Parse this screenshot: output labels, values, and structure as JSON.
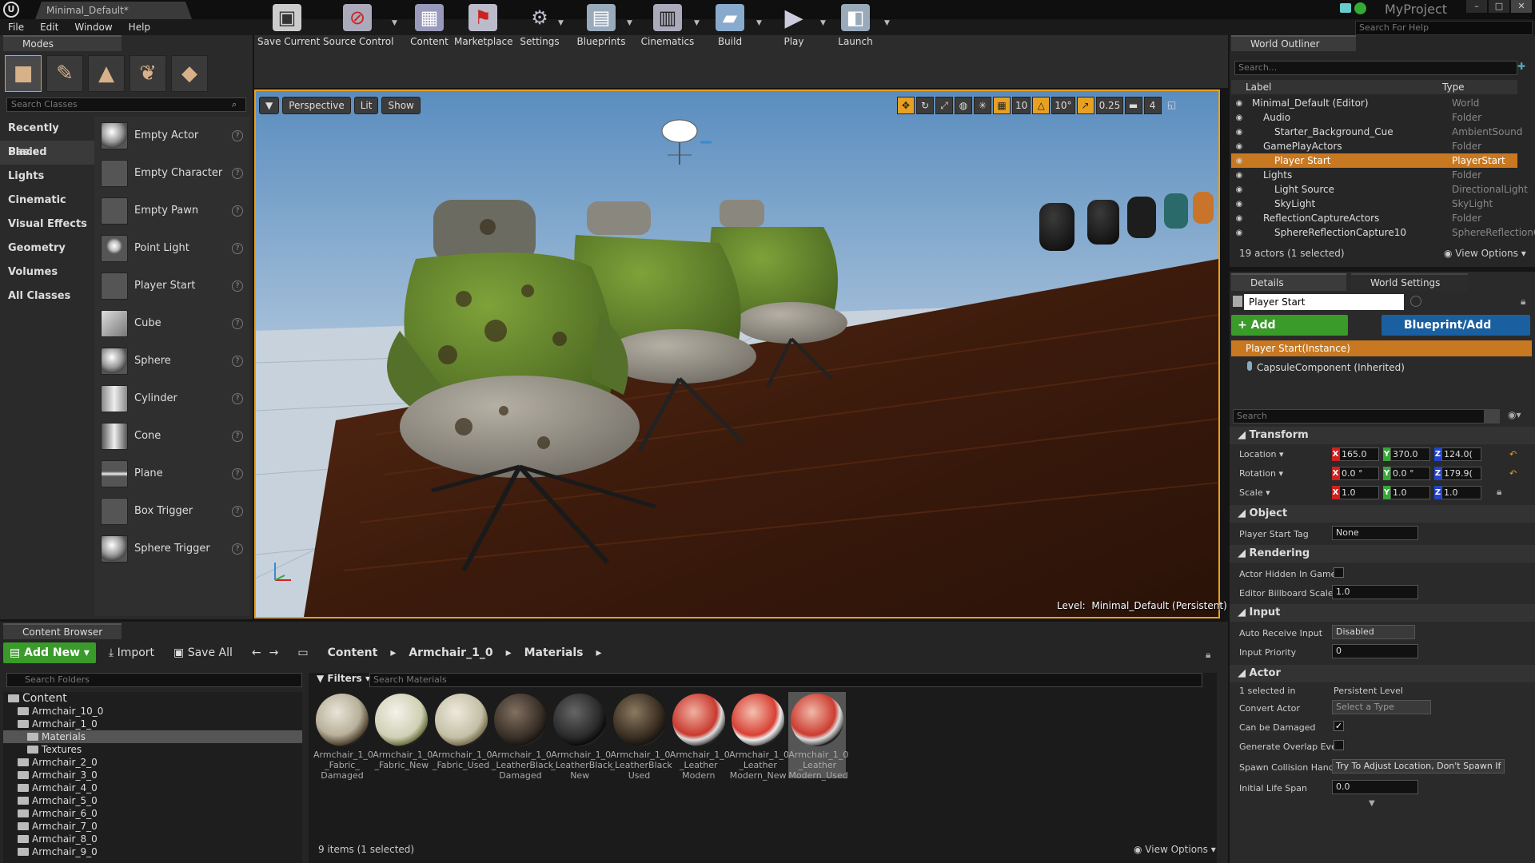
{
  "window": {
    "tab": "Minimal_Default*",
    "project": "MyProject"
  },
  "menu": [
    "File",
    "Edit",
    "Window",
    "Help"
  ],
  "help_search": "Search For Help",
  "modes": {
    "tab": "Modes",
    "search_placeholder": "Search Classes",
    "categories": [
      "Recently Placed",
      "Basic",
      "Lights",
      "Cinematic",
      "Visual Effects",
      "Geometry",
      "Volumes",
      "All Classes"
    ],
    "actors": [
      "Empty Actor",
      "Empty Character",
      "Empty Pawn",
      "Point Light",
      "Player Start",
      "Cube",
      "Sphere",
      "Cylinder",
      "Cone",
      "Plane",
      "Box Trigger",
      "Sphere Trigger"
    ]
  },
  "toolbar": [
    "Save Current",
    "Source Control",
    "Content",
    "Marketplace",
    "Settings",
    "Blueprints",
    "Cinematics",
    "Build",
    "Play",
    "Launch"
  ],
  "viewport": {
    "perspective": "Perspective",
    "lit": "Lit",
    "show": "Show",
    "grid_snap": "10",
    "rot_snap": "10°",
    "scale_snap": "0.25",
    "cam_speed": "4",
    "level_prefix": "Level:",
    "level_name": "Minimal_Default (Persistent)"
  },
  "content_browser": {
    "tab": "Content Browser",
    "add_new": "Add New",
    "import": "Import",
    "save_all": "Save All",
    "breadcrumb": [
      "Content",
      "Armchair_1_0",
      "Materials"
    ],
    "search_folders": "Search Folders",
    "filters": "Filters",
    "search_materials": "Search Materials",
    "folders": [
      {
        "name": "Content",
        "level": 0
      },
      {
        "name": "Armchair_10_0",
        "level": 1
      },
      {
        "name": "Armchair_1_0",
        "level": 1
      },
      {
        "name": "Materials",
        "level": 2
      },
      {
        "name": "Textures",
        "level": 2
      },
      {
        "name": "Armchair_2_0",
        "level": 1
      },
      {
        "name": "Armchair_3_0",
        "level": 1
      },
      {
        "name": "Armchair_4_0",
        "level": 1
      },
      {
        "name": "Armchair_5_0",
        "level": 1
      },
      {
        "name": "Armchair_6_0",
        "level": 1
      },
      {
        "name": "Armchair_7_0",
        "level": 1
      },
      {
        "name": "Armchair_8_0",
        "level": 1
      },
      {
        "name": "Armchair_9_0",
        "level": 1
      }
    ],
    "assets": [
      [
        "Armchair_1_0",
        "_Fabric_",
        "Damaged"
      ],
      [
        "Armchair_1_0",
        "_Fabric_New",
        ""
      ],
      [
        "Armchair_1_0",
        "_Fabric_Used",
        ""
      ],
      [
        "Armchair_1_0",
        "_LeatherBlack",
        "Damaged"
      ],
      [
        "Armchair_1_0",
        "_LeatherBlack",
        "New"
      ],
      [
        "Armchair_1_0",
        "_LeatherBlack",
        "Used"
      ],
      [
        "Armchair_1_0",
        "_Leather",
        "Modern"
      ],
      [
        "Armchair_1_0",
        "_Leather",
        "Modern_New"
      ],
      [
        "Armchair_1_0",
        "_Leather",
        "Modern_Used"
      ]
    ],
    "items_count": "9 items (1 selected)",
    "view_options": "View Options"
  },
  "outliner": {
    "tab": "World Outliner",
    "search": "Search...",
    "col_label": "Label",
    "col_type": "Type",
    "rows": [
      {
        "label": "Minimal_Default (Editor)",
        "type": "World",
        "indent": 0
      },
      {
        "label": "Audio",
        "type": "Folder",
        "indent": 1
      },
      {
        "label": "Starter_Background_Cue",
        "type": "AmbientSound",
        "indent": 2
      },
      {
        "label": "GamePlayActors",
        "type": "Folder",
        "indent": 1
      },
      {
        "label": "Player Start",
        "type": "PlayerStart",
        "indent": 2
      },
      {
        "label": "Lights",
        "type": "Folder",
        "indent": 1
      },
      {
        "label": "Light Source",
        "type": "DirectionalLight",
        "indent": 2
      },
      {
        "label": "SkyLight",
        "type": "SkyLight",
        "indent": 2
      },
      {
        "label": "ReflectionCaptureActors",
        "type": "Folder",
        "indent": 1
      },
      {
        "label": "SphereReflectionCapture10",
        "type": "SphereReflectionC",
        "indent": 2
      }
    ],
    "footer": "19 actors (1 selected)",
    "view_options": "View Options"
  },
  "details": {
    "tab": "Details",
    "tab2": "World Settings",
    "name": "Player Start",
    "add_component": "Add Component",
    "blueprint_script": "Blueprint/Add Script",
    "instance": "Player Start(Instance)",
    "capsule": "CapsuleComponent (Inherited)",
    "search": "Search",
    "transform": "Transform",
    "location_lbl": "Location",
    "rotation_lbl": "Rotation",
    "scale_lbl": "Scale",
    "location": [
      "165.0",
      "370.0",
      "124.0("
    ],
    "rotation": [
      "0.0 °",
      "0.0 °",
      "179.9("
    ],
    "scale": [
      "1.0",
      "1.0",
      "1.0"
    ],
    "object": "Object",
    "player_start_tag_lbl": "Player Start Tag",
    "player_start_tag": "None",
    "rendering": "Rendering",
    "actor_hidden_lbl": "Actor Hidden In Game",
    "billboard_lbl": "Editor Billboard Scale",
    "billboard": "1.0",
    "input": "Input",
    "auto_receive_lbl": "Auto Receive Input",
    "auto_receive": "Disabled",
    "input_priority_lbl": "Input Priority",
    "input_priority": "0",
    "actor": "Actor",
    "selected_in_lbl": "1 selected in",
    "selected_in": "Persistent Level",
    "convert_actor_lbl": "Convert Actor",
    "convert_actor": "Select a Type",
    "can_be_damaged_lbl": "Can be Damaged",
    "gen_overlap_lbl": "Generate Overlap Evei",
    "spawn_collision_lbl": "Spawn Collision Handl",
    "spawn_collision": "Try To Adjust Location, Don't Spawn If",
    "life_span_lbl": "Initial Life Span",
    "life_span": "0.0"
  }
}
